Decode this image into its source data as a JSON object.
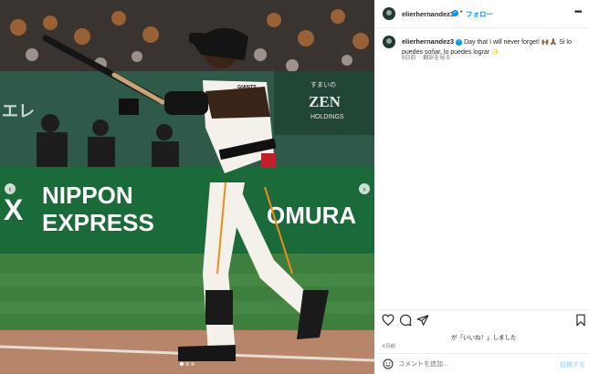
{
  "photo": {
    "signs": {
      "wall_left": "エレ",
      "billboard_small": "すまいの",
      "billboard_brand": "ZEN",
      "billboard_sub": "HOLDINGS",
      "ad_line1": "NIPPON",
      "ad_line2": "EXPRESS",
      "ad_right": "OMURA",
      "ad_logo_mark": "X",
      "jersey_text": "GIANTS"
    },
    "nav_prev_icon": "chevron-left-icon",
    "nav_next_icon": "chevron-right-icon",
    "slide_count": 3,
    "active_slide": 1
  },
  "header": {
    "username": "elierhernandez3",
    "separator": "•",
    "follow_label": "フォロー",
    "more_icon": "more-horizontal-icon"
  },
  "caption": {
    "username": "elierhernandez3",
    "text": "Day that I will never forget! 🙌🏾🙏🏾 Si lo puedes soñar, lo puedes lograr ✨",
    "age": "6日前",
    "translate_label": "翻訳を見る"
  },
  "actions": {
    "like_icon": "heart-icon",
    "comment_icon": "comment-icon",
    "share_icon": "share-icon",
    "save_icon": "bookmark-icon",
    "likes_text": "が「いいね！」しました",
    "timestamp": "6日前"
  },
  "comment": {
    "placeholder": "コメントを追加...",
    "post_label": "投稿する",
    "emoji_icon": "emoji-icon"
  },
  "colors": {
    "accent": "#0095f6",
    "uniform_orange": "#f08c1a",
    "field_green": "#3f7f3e",
    "dirt": "#b7856a"
  }
}
